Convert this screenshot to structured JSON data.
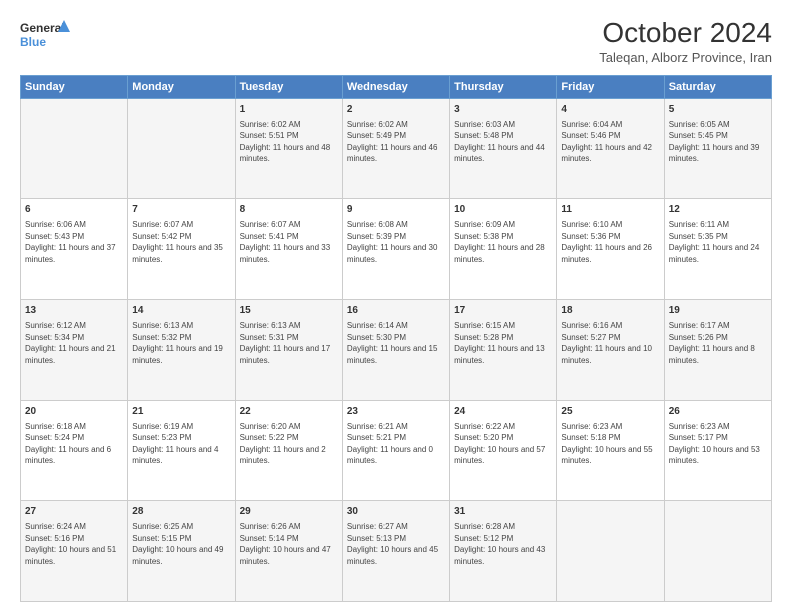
{
  "header": {
    "logo_line1": "General",
    "logo_line2": "Blue",
    "title": "October 2024",
    "subtitle": "Taleqan, Alborz Province, Iran"
  },
  "weekdays": [
    "Sunday",
    "Monday",
    "Tuesday",
    "Wednesday",
    "Thursday",
    "Friday",
    "Saturday"
  ],
  "weeks": [
    [
      {
        "day": "",
        "text": ""
      },
      {
        "day": "",
        "text": ""
      },
      {
        "day": "1",
        "text": "Sunrise: 6:02 AM\nSunset: 5:51 PM\nDaylight: 11 hours and 48 minutes."
      },
      {
        "day": "2",
        "text": "Sunrise: 6:02 AM\nSunset: 5:49 PM\nDaylight: 11 hours and 46 minutes."
      },
      {
        "day": "3",
        "text": "Sunrise: 6:03 AM\nSunset: 5:48 PM\nDaylight: 11 hours and 44 minutes."
      },
      {
        "day": "4",
        "text": "Sunrise: 6:04 AM\nSunset: 5:46 PM\nDaylight: 11 hours and 42 minutes."
      },
      {
        "day": "5",
        "text": "Sunrise: 6:05 AM\nSunset: 5:45 PM\nDaylight: 11 hours and 39 minutes."
      }
    ],
    [
      {
        "day": "6",
        "text": "Sunrise: 6:06 AM\nSunset: 5:43 PM\nDaylight: 11 hours and 37 minutes."
      },
      {
        "day": "7",
        "text": "Sunrise: 6:07 AM\nSunset: 5:42 PM\nDaylight: 11 hours and 35 minutes."
      },
      {
        "day": "8",
        "text": "Sunrise: 6:07 AM\nSunset: 5:41 PM\nDaylight: 11 hours and 33 minutes."
      },
      {
        "day": "9",
        "text": "Sunrise: 6:08 AM\nSunset: 5:39 PM\nDaylight: 11 hours and 30 minutes."
      },
      {
        "day": "10",
        "text": "Sunrise: 6:09 AM\nSunset: 5:38 PM\nDaylight: 11 hours and 28 minutes."
      },
      {
        "day": "11",
        "text": "Sunrise: 6:10 AM\nSunset: 5:36 PM\nDaylight: 11 hours and 26 minutes."
      },
      {
        "day": "12",
        "text": "Sunrise: 6:11 AM\nSunset: 5:35 PM\nDaylight: 11 hours and 24 minutes."
      }
    ],
    [
      {
        "day": "13",
        "text": "Sunrise: 6:12 AM\nSunset: 5:34 PM\nDaylight: 11 hours and 21 minutes."
      },
      {
        "day": "14",
        "text": "Sunrise: 6:13 AM\nSunset: 5:32 PM\nDaylight: 11 hours and 19 minutes."
      },
      {
        "day": "15",
        "text": "Sunrise: 6:13 AM\nSunset: 5:31 PM\nDaylight: 11 hours and 17 minutes."
      },
      {
        "day": "16",
        "text": "Sunrise: 6:14 AM\nSunset: 5:30 PM\nDaylight: 11 hours and 15 minutes."
      },
      {
        "day": "17",
        "text": "Sunrise: 6:15 AM\nSunset: 5:28 PM\nDaylight: 11 hours and 13 minutes."
      },
      {
        "day": "18",
        "text": "Sunrise: 6:16 AM\nSunset: 5:27 PM\nDaylight: 11 hours and 10 minutes."
      },
      {
        "day": "19",
        "text": "Sunrise: 6:17 AM\nSunset: 5:26 PM\nDaylight: 11 hours and 8 minutes."
      }
    ],
    [
      {
        "day": "20",
        "text": "Sunrise: 6:18 AM\nSunset: 5:24 PM\nDaylight: 11 hours and 6 minutes."
      },
      {
        "day": "21",
        "text": "Sunrise: 6:19 AM\nSunset: 5:23 PM\nDaylight: 11 hours and 4 minutes."
      },
      {
        "day": "22",
        "text": "Sunrise: 6:20 AM\nSunset: 5:22 PM\nDaylight: 11 hours and 2 minutes."
      },
      {
        "day": "23",
        "text": "Sunrise: 6:21 AM\nSunset: 5:21 PM\nDaylight: 11 hours and 0 minutes."
      },
      {
        "day": "24",
        "text": "Sunrise: 6:22 AM\nSunset: 5:20 PM\nDaylight: 10 hours and 57 minutes."
      },
      {
        "day": "25",
        "text": "Sunrise: 6:23 AM\nSunset: 5:18 PM\nDaylight: 10 hours and 55 minutes."
      },
      {
        "day": "26",
        "text": "Sunrise: 6:23 AM\nSunset: 5:17 PM\nDaylight: 10 hours and 53 minutes."
      }
    ],
    [
      {
        "day": "27",
        "text": "Sunrise: 6:24 AM\nSunset: 5:16 PM\nDaylight: 10 hours and 51 minutes."
      },
      {
        "day": "28",
        "text": "Sunrise: 6:25 AM\nSunset: 5:15 PM\nDaylight: 10 hours and 49 minutes."
      },
      {
        "day": "29",
        "text": "Sunrise: 6:26 AM\nSunset: 5:14 PM\nDaylight: 10 hours and 47 minutes."
      },
      {
        "day": "30",
        "text": "Sunrise: 6:27 AM\nSunset: 5:13 PM\nDaylight: 10 hours and 45 minutes."
      },
      {
        "day": "31",
        "text": "Sunrise: 6:28 AM\nSunset: 5:12 PM\nDaylight: 10 hours and 43 minutes."
      },
      {
        "day": "",
        "text": ""
      },
      {
        "day": "",
        "text": ""
      }
    ]
  ]
}
